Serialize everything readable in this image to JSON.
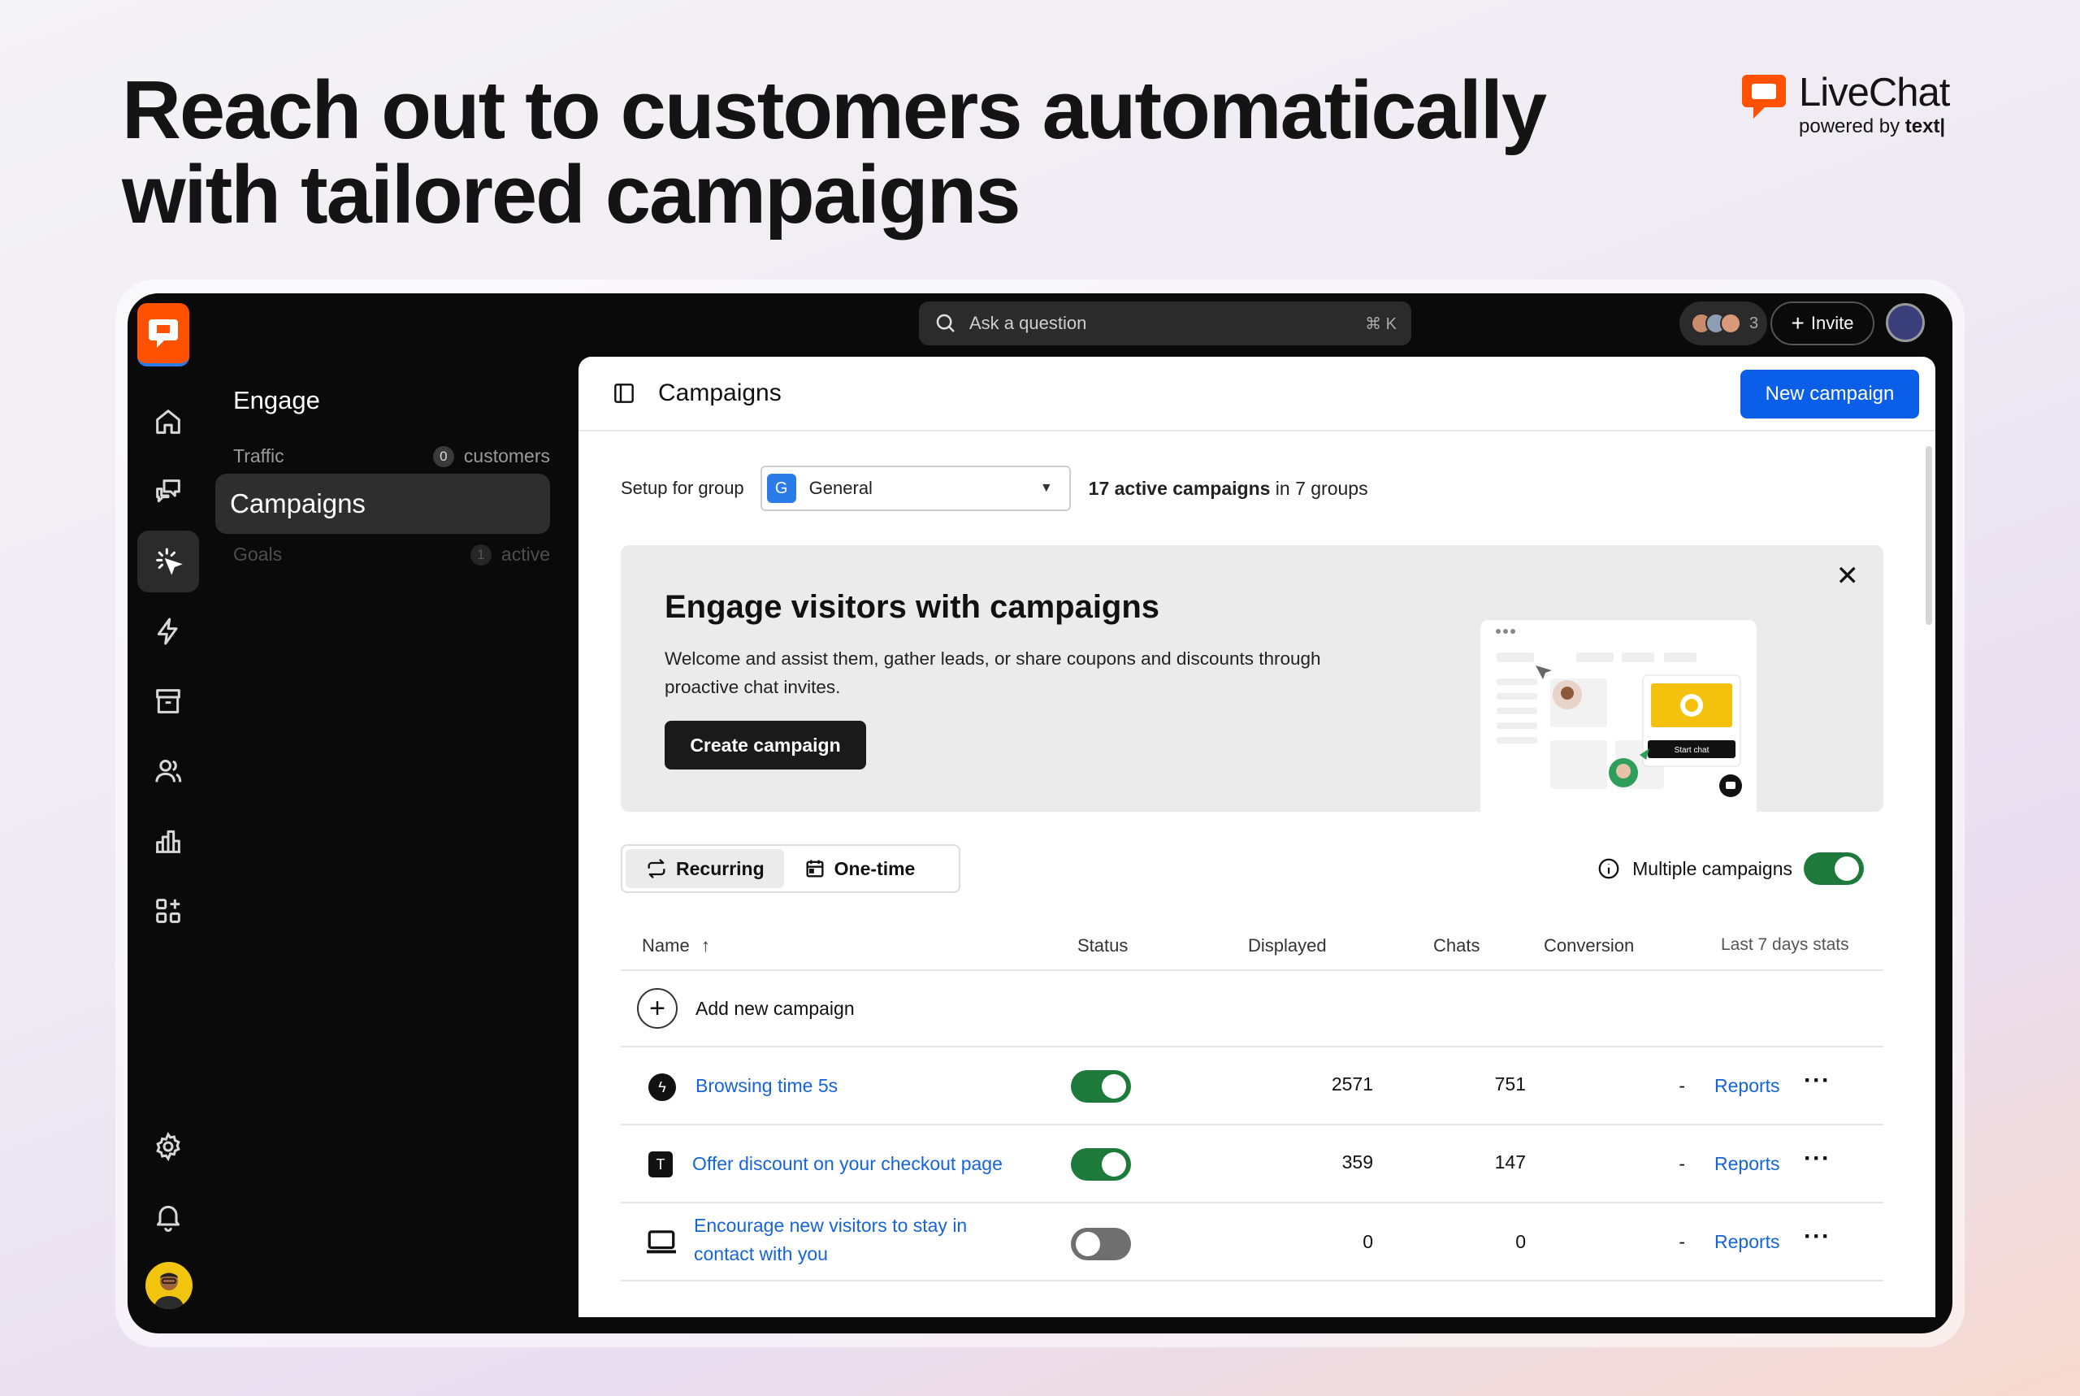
{
  "headline": {
    "line1": "Reach out to customers automatically",
    "line2": "with tailored campaigns"
  },
  "brand": {
    "name": "LiveChat",
    "powered_prefix": "powered by ",
    "powered_by": "text|"
  },
  "topbar": {
    "search_placeholder": "Ask a question",
    "search_shortcut": "⌘ K",
    "team_count": "3",
    "invite_label": "Invite"
  },
  "subnav": {
    "title": "Engage",
    "items": [
      {
        "label": "Traffic",
        "count": "0",
        "count_label": "customers"
      },
      {
        "label": "Campaigns"
      },
      {
        "label": "Goals",
        "count": "1",
        "count_label": "active"
      }
    ]
  },
  "main": {
    "title": "Campaigns",
    "new_button": "New campaign",
    "group_label": "Setup for group",
    "group_badge": "G",
    "group_value": "General",
    "active_count_bold": "17 active campaigns",
    "active_count_rest": " in 7 groups"
  },
  "banner": {
    "title": "Engage visitors with campaigns",
    "text": "Welcome and assist them, gather leads, or share coupons and discounts through proactive chat invites.",
    "button": "Create campaign",
    "illustration_button": "Start chat"
  },
  "tabs": [
    {
      "label": "Recurring",
      "active": true
    },
    {
      "label": "One-time",
      "active": false
    }
  ],
  "multiple_campaigns": {
    "label": "Multiple campaigns",
    "enabled": true
  },
  "table": {
    "headers": {
      "name": "Name",
      "status": "Status",
      "displayed": "Displayed",
      "chats": "Chats",
      "conversion": "Conversion",
      "stats": "Last 7 days stats"
    },
    "add_label": "Add new campaign",
    "rows": [
      {
        "icon": "bolt-icon",
        "name": "Browsing time 5s",
        "enabled": true,
        "displayed": "2571",
        "chats": "751",
        "conversion": "-",
        "stats": "Reports"
      },
      {
        "icon": "text-t-icon",
        "name": "Offer discount on your checkout page",
        "enabled": true,
        "displayed": "359",
        "chats": "147",
        "conversion": "-",
        "stats": "Reports"
      },
      {
        "icon": "laptop-icon",
        "name_line1": "Encourage new visitors to stay in",
        "name_line2": "contact with you",
        "enabled": false,
        "displayed": "0",
        "chats": "0",
        "conversion": "-",
        "stats": "Reports"
      }
    ]
  },
  "colors": {
    "accent": "#0b5ee8",
    "brand": "#ff5100",
    "toggle_on": "#1d7a3a",
    "link": "#1664d9"
  }
}
